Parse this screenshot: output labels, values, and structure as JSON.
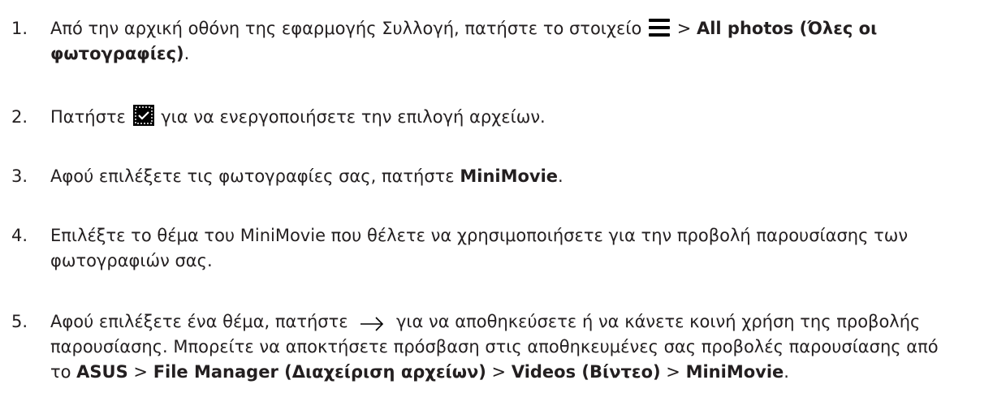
{
  "steps": [
    {
      "num": "1.",
      "parts": [
        {
          "t": "Από την αρχική οθόνη της εφαρμογής Συλλογή, πατήστε το στοιχείο "
        },
        {
          "icon": "menu-icon"
        },
        {
          "t": " > "
        },
        {
          "t": "All photos (Όλες οι φωτογραφίες)",
          "b": true
        },
        {
          "t": "."
        }
      ]
    },
    {
      "num": "2.",
      "parts": [
        {
          "t": "Πατήστε "
        },
        {
          "icon": "select-files-icon"
        },
        {
          "t": " για να ενεργοποιήσετε την επιλογή αρχείων."
        }
      ]
    },
    {
      "num": "3.",
      "parts": [
        {
          "t": "Αφού επιλέξετε τις φωτογραφίες σας, πατήστε "
        },
        {
          "t": "MiniMovie",
          "b": true
        },
        {
          "t": "."
        }
      ]
    },
    {
      "num": "4.",
      "parts": [
        {
          "t": "Επιλέξτε το θέμα του MiniMovie που θέλετε να χρησιμοποιήσετε για την προβολή παρουσίασης των φωτογραφιών σας."
        }
      ]
    },
    {
      "num": "5.",
      "parts": [
        {
          "t": "Αφού επιλέξετε ένα θέμα, πατήστε "
        },
        {
          "icon": "arrow-right-icon"
        },
        {
          "t": " για να αποθηκεύσετε ή να κάνετε κοινή χρήση της προβολής παρουσίασης. Μπορείτε να αποκτήσετε πρόσβαση στις αποθηκευμένες σας προβολές παρουσίασης από το "
        },
        {
          "t": "ASUS",
          "b": true
        },
        {
          "t": " > "
        },
        {
          "t": "File Manager (Διαχείριση αρχείων)",
          "b": true
        },
        {
          "t": " > "
        },
        {
          "t": "Videos (Βίντεο)",
          "b": true
        },
        {
          "t": " > "
        },
        {
          "t": "MiniMovie",
          "b": true
        },
        {
          "t": "."
        }
      ]
    }
  ]
}
